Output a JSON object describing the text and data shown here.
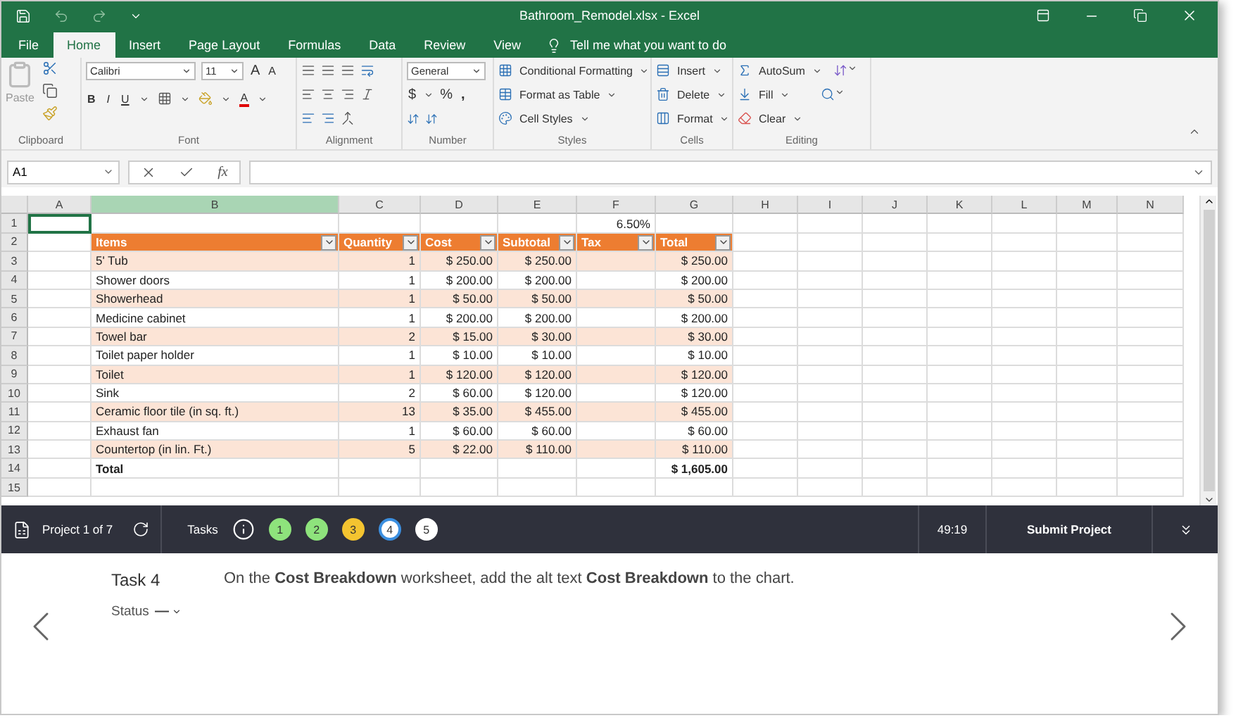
{
  "title_bar": {
    "title": "Bathroom_Remodel.xlsx - Excel"
  },
  "ribbon_tabs": [
    {
      "label": "File",
      "selected": false
    },
    {
      "label": "Home",
      "selected": true
    },
    {
      "label": "Insert",
      "selected": false
    },
    {
      "label": "Page Layout",
      "selected": false
    },
    {
      "label": "Formulas",
      "selected": false
    },
    {
      "label": "Data",
      "selected": false
    },
    {
      "label": "Review",
      "selected": false
    },
    {
      "label": "View",
      "selected": false
    }
  ],
  "tell_me": {
    "placeholder": "Tell me what you want to do"
  },
  "ribbon": {
    "clipboard": {
      "label": "Clipboard",
      "paste": "Paste"
    },
    "font": {
      "label": "Font",
      "font_name": "Calibri",
      "font_size": "11",
      "grow": "A",
      "shrink": "A",
      "bold": "B",
      "italic": "I",
      "underline": "U",
      "font_color": "A"
    },
    "alignment": {
      "label": "Alignment"
    },
    "number": {
      "label": "Number",
      "format": "General",
      "currency": "$",
      "percent": "%",
      "comma": ","
    },
    "styles": {
      "label": "Styles",
      "items": [
        "Conditional Formatting",
        "Format as Table",
        "Cell Styles"
      ]
    },
    "cells": {
      "label": "Cells",
      "items": [
        "Insert",
        "Delete",
        "Format"
      ]
    },
    "editing": {
      "label": "Editing",
      "items": [
        "AutoSum",
        "Fill",
        "Clear"
      ]
    }
  },
  "formula_bar": {
    "name_box": "A1",
    "function_button": "fx"
  },
  "sheet": {
    "columns": [
      {
        "label": "A",
        "selected": false
      },
      {
        "label": "B",
        "selected": true
      },
      {
        "label": "C",
        "selected": false
      },
      {
        "label": "D",
        "selected": false
      },
      {
        "label": "E",
        "selected": false
      },
      {
        "label": "F",
        "selected": false
      },
      {
        "label": "G",
        "selected": false
      },
      {
        "label": "H",
        "selected": false
      },
      {
        "label": "I",
        "selected": false
      },
      {
        "label": "J",
        "selected": false
      },
      {
        "label": "K",
        "selected": false
      },
      {
        "label": "L",
        "selected": false
      },
      {
        "label": "M",
        "selected": false
      },
      {
        "label": "N",
        "selected": false
      }
    ],
    "rows": [
      {
        "number": "1",
        "kind": "plain",
        "banded": false,
        "cells": {
          "F": "6.50%"
        }
      },
      {
        "number": "2",
        "kind": "header",
        "cells": {
          "B": "Items",
          "C": "Quantity",
          "D": "Cost",
          "E": "Subtotal",
          "F": "Tax",
          "G": "Total"
        }
      },
      {
        "number": "3",
        "kind": "data",
        "banded": true,
        "cells": {
          "B": "5' Tub",
          "C": "1",
          "D": "$ 250.00",
          "E": "$ 250.00",
          "G": "$ 250.00"
        }
      },
      {
        "number": "4",
        "kind": "data",
        "banded": false,
        "cells": {
          "B": "Shower doors",
          "C": "1",
          "D": "$ 200.00",
          "E": "$ 200.00",
          "G": "$ 200.00"
        }
      },
      {
        "number": "5",
        "kind": "data",
        "banded": true,
        "cells": {
          "B": "Showerhead",
          "C": "1",
          "D": "$ 50.00",
          "E": "$ 50.00",
          "G": "$ 50.00"
        }
      },
      {
        "number": "6",
        "kind": "data",
        "banded": false,
        "cells": {
          "B": "Medicine cabinet",
          "C": "1",
          "D": "$ 200.00",
          "E": "$ 200.00",
          "G": "$ 200.00"
        }
      },
      {
        "number": "7",
        "kind": "data",
        "banded": true,
        "cells": {
          "B": "Towel bar",
          "C": "2",
          "D": "$ 15.00",
          "E": "$ 30.00",
          "G": "$ 30.00"
        }
      },
      {
        "number": "8",
        "kind": "data",
        "banded": false,
        "cells": {
          "B": "Toilet paper holder",
          "C": "1",
          "D": "$ 10.00",
          "E": "$ 10.00",
          "G": "$ 10.00"
        }
      },
      {
        "number": "9",
        "kind": "data",
        "banded": true,
        "cells": {
          "B": "Toilet",
          "C": "1",
          "D": "$ 120.00",
          "E": "$ 120.00",
          "G": "$ 120.00"
        }
      },
      {
        "number": "10",
        "kind": "data",
        "banded": false,
        "cells": {
          "B": "Sink",
          "C": "2",
          "D": "$ 60.00",
          "E": "$ 120.00",
          "G": "$ 120.00"
        }
      },
      {
        "number": "11",
        "kind": "data",
        "banded": true,
        "cells": {
          "B": "Ceramic floor tile (in sq. ft.)",
          "C": "13",
          "D": "$ 35.00",
          "E": "$ 455.00",
          "G": "$ 455.00"
        }
      },
      {
        "number": "12",
        "kind": "data",
        "banded": false,
        "cells": {
          "B": "Exhaust fan",
          "C": "1",
          "D": "$ 60.00",
          "E": "$ 60.00",
          "G": "$ 60.00"
        }
      },
      {
        "number": "13",
        "kind": "data",
        "banded": true,
        "cells": {
          "B": "Countertop (in lin. Ft.)",
          "C": "5",
          "D": "$ 22.00",
          "E": "$ 110.00",
          "G": "$ 110.00"
        }
      },
      {
        "number": "14",
        "kind": "total",
        "banded": false,
        "cells": {
          "B": "Total",
          "G": "$ 1,605.00"
        }
      },
      {
        "number": "15",
        "kind": "plain",
        "banded": false,
        "cells": {}
      }
    ]
  },
  "task_bar": {
    "project": "Project 1 of 7",
    "tasks_label": "Tasks",
    "tasks": [
      {
        "label": "1",
        "color": "#8ee37c",
        "selected": false
      },
      {
        "label": "2",
        "color": "#8ee37c",
        "selected": false
      },
      {
        "label": "3",
        "color": "#f4c430",
        "selected": false
      },
      {
        "label": "4",
        "color": "#ffffff",
        "selected": true
      },
      {
        "label": "5",
        "color": "#ffffff",
        "selected": false
      }
    ],
    "timer": "49:19",
    "submit": "Submit Project"
  },
  "task_panel": {
    "title": "Task 4",
    "instruction": "On the **Cost Breakdown** worksheet, add the alt text **Cost Breakdown** to the chart.",
    "status_label": "Status",
    "status_value": "—"
  }
}
